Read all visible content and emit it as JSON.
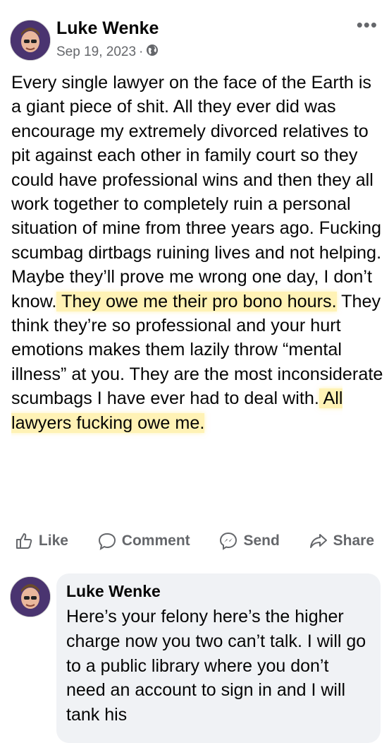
{
  "post": {
    "author": "Luke Wenke",
    "date": "Sep 19, 2023",
    "separator": "·",
    "privacy_icon": "globe-icon",
    "more_icon": "more-options-icon",
    "body_segments": [
      {
        "text": "Every single lawyer on the face of the Earth is a giant piece of shit.  All they ever did was encourage my extremely divorced relatives to pit against each other in family court so they could have professional wins and then they all work together to completely ruin a personal situation of mine from three years ago. Fucking scumbag dirtbags ruining lives and not helping.  Maybe they’ll prove me wrong one day, I don’t know.",
        "highlight": false
      },
      {
        "text": "  They owe me their pro bono hours.",
        "highlight": true
      },
      {
        "text": "  They think they’re so professional and your hurt emotions makes them lazily throw “mental illness” at you.  They are the most inconsiderate scumbags I have ever had to deal with.",
        "highlight": false
      },
      {
        "text": "  All lawyers fucking owe me.",
        "highlight": true
      }
    ]
  },
  "actions": {
    "like": "Like",
    "comment": "Comment",
    "send": "Send",
    "share": "Share"
  },
  "comment": {
    "author": "Luke Wenke",
    "text": "Here’s your felony here’s the higher charge now you two can’t talk.  I will go to a public library where you don’t need an account to sign in and I will tank his"
  },
  "colors": {
    "highlight": "#FFE778",
    "secondary_text": "#65676b",
    "bubble": "#f0f2f5"
  }
}
